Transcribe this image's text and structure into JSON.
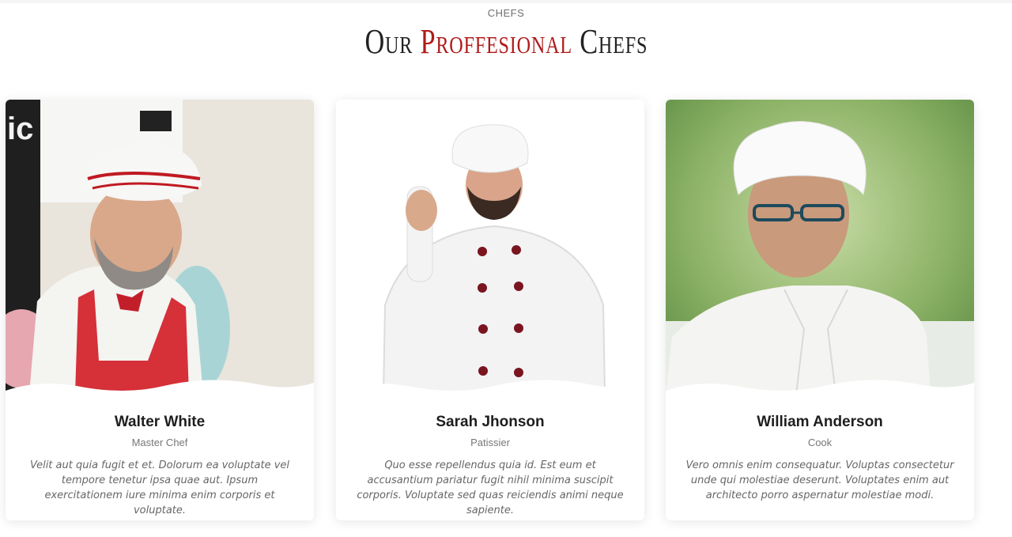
{
  "section": {
    "eyebrow": "CHEFS",
    "title_part1": "Our ",
    "title_accent": "Proffesional",
    "title_part2": " Chefs"
  },
  "colors": {
    "accent": "#b01b1b",
    "text": "#222222",
    "muted": "#777777"
  },
  "chefs": [
    {
      "name": "Walter White",
      "role": "Master Chef",
      "description": "Velit aut quia fugit et et. Dolorum ea voluptate vel tempore tenetur ipsa quae aut. Ipsum exercitationem iure minima enim corporis et voluptate."
    },
    {
      "name": "Sarah Jhonson",
      "role": "Patissier",
      "description": "Quo esse repellendus quia id. Est eum et accusantium pariatur fugit nihil minima suscipit corporis. Voluptate sed quas reiciendis animi neque sapiente."
    },
    {
      "name": "William Anderson",
      "role": "Cook",
      "description": "Vero omnis enim consequatur. Voluptas consectetur unde qui molestiae deserunt. Voluptates enim aut architecto porro aspernatur molestiae modi."
    }
  ]
}
